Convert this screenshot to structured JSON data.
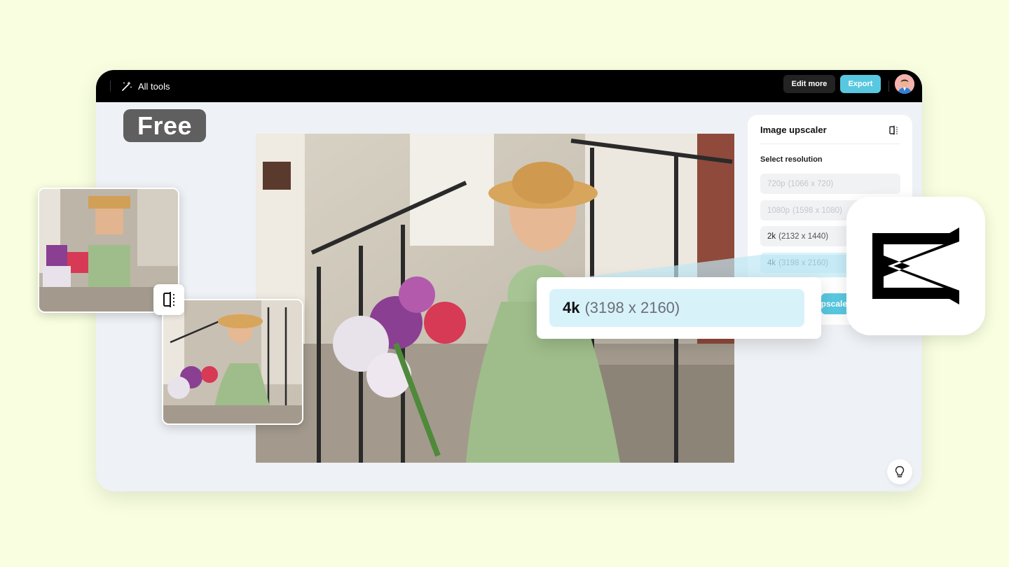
{
  "topbar": {
    "all_tools_label": "All tools",
    "edit_more_label": "Edit more",
    "export_label": "Export"
  },
  "badge": {
    "free_label": "Free"
  },
  "panel": {
    "title": "Image upscaler",
    "select_label": "Select resolution",
    "options": [
      {
        "key": "720p",
        "detail": "(1066 x 720)",
        "state": "disabled"
      },
      {
        "key": "1080p",
        "detail": "(1598 x 1080)",
        "state": "disabled"
      },
      {
        "key": "2k",
        "detail": "(2132 x 1440)",
        "state": "normal"
      },
      {
        "key": "4k",
        "detail": "(3198 x 2160)",
        "state": "selected"
      }
    ],
    "upscale_label": "Upscale"
  },
  "callout": {
    "key": "4k",
    "detail": "(3198 x 2160)"
  },
  "colors": {
    "background": "#f8fedf",
    "accent": "#58c8e0",
    "selected_option": "#d8f2fa",
    "badge": "#5f5f5f"
  },
  "icons": {
    "all_tools": "magic-wand-icon",
    "panel_compare": "compare-icon",
    "thumb_compare": "compare-slider-icon",
    "hint": "lightbulb-icon",
    "logo": "capcut-logo"
  }
}
